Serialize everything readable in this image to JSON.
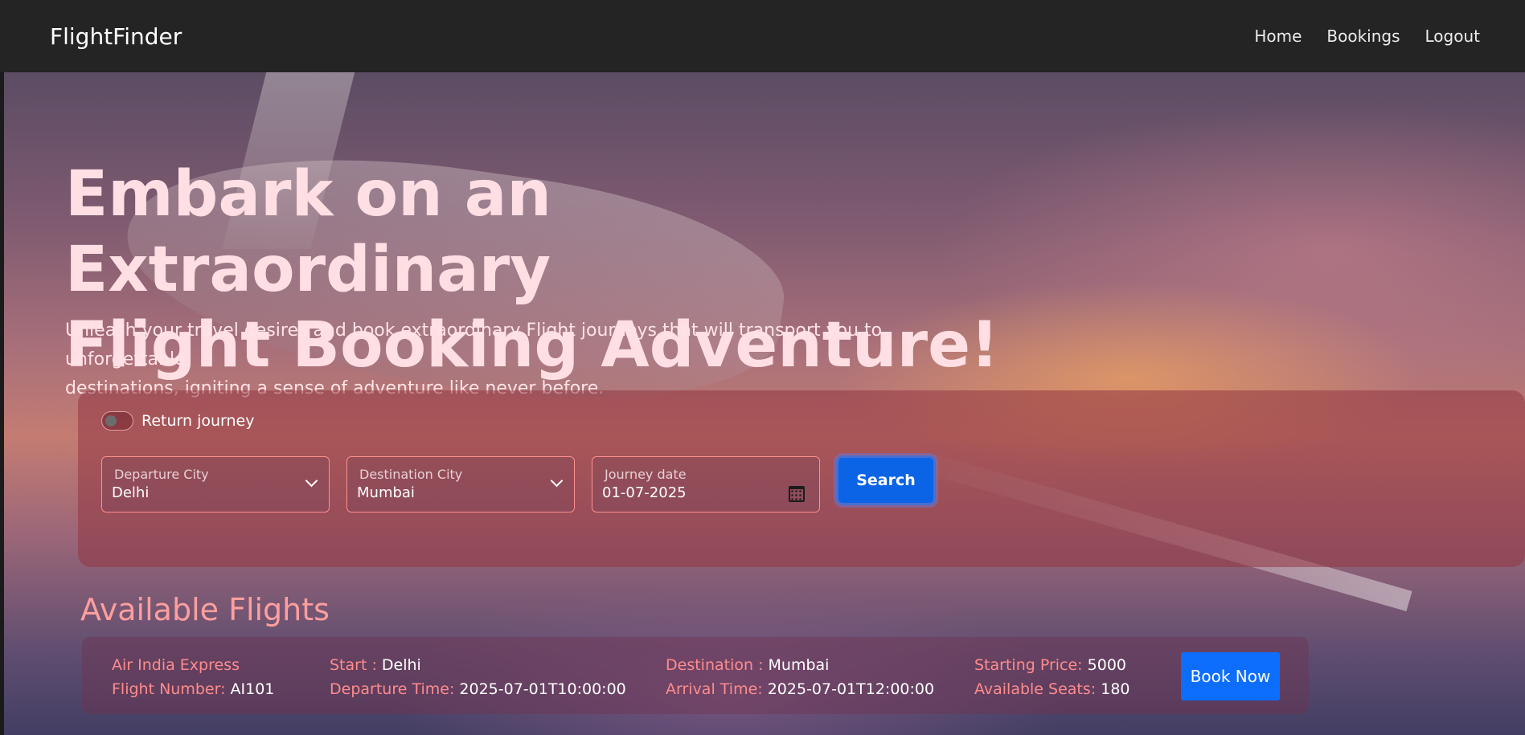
{
  "navbar": {
    "brand": "FlightFinder",
    "links": [
      "Home",
      "Bookings",
      "Logout"
    ]
  },
  "hero": {
    "headline_line1": "Embark on an Extraordinary",
    "headline_line2": "Flight Booking Adventure!",
    "subline_line1": "Unleash your travel desires and book extraordinary Flight journeys that will transport you to unforgettable",
    "subline_line2": "destinations, igniting a sense of adventure like never before."
  },
  "search": {
    "return_toggle_label": "Return journey",
    "return_toggle_on": false,
    "departure_label": "Departure City",
    "departure_value": "Delhi",
    "destination_label": "Destination City",
    "destination_value": "Mumbai",
    "date_label": "Journey date",
    "date_value": "01-07-2025",
    "search_label": "Search"
  },
  "results": {
    "title": "Available Flights",
    "flights": [
      {
        "airline": "Air India Express",
        "flight_number_label": "Flight Number:",
        "flight_number": "AI101",
        "start_label": "Start :",
        "start": "Delhi",
        "departure_time_label": "Departure Time:",
        "departure_time": "2025-07-01T10:00:00",
        "destination_label": "Destination :",
        "destination": "Mumbai",
        "arrival_time_label": "Arrival Time:",
        "arrival_time": "2025-07-01T12:00:00",
        "price_label": "Starting Price:",
        "price": "5000",
        "seats_label": "Available Seats:",
        "seats": "180",
        "book_label": "Book Now"
      }
    ]
  },
  "colors": {
    "navbar": "#242424",
    "accent_text": "#ff8c8c",
    "primary_button": "#0d6efd"
  }
}
